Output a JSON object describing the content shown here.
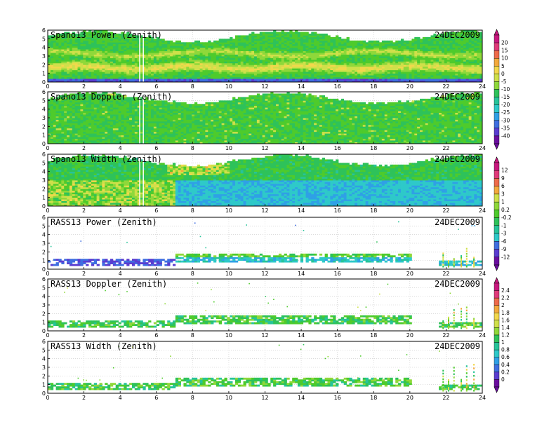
{
  "chart_data": [
    {
      "type": "heatmap",
      "title": "Spano13 Power (Zenith)",
      "date": "24DEC2009",
      "x_ticks": [
        "0",
        "2",
        "4",
        "6",
        "8",
        "10",
        "12",
        "14",
        "16",
        "18",
        "20",
        "22",
        "24"
      ],
      "y_ticks": [
        "0",
        "1",
        "2",
        "3",
        "4",
        "5",
        "6"
      ],
      "xlim": [
        0,
        24
      ],
      "ylim": [
        0,
        6
      ],
      "kind": "profiler-power",
      "colorbar": "snr"
    },
    {
      "type": "heatmap",
      "title": "Spano13 Doppler (Zenith)",
      "date": "24DEC2009",
      "x_ticks": [
        "0",
        "2",
        "4",
        "6",
        "8",
        "10",
        "12",
        "14",
        "16",
        "18",
        "20",
        "22",
        "24"
      ],
      "y_ticks": [
        "0",
        "1",
        "2",
        "3",
        "4",
        "5",
        "6"
      ],
      "xlim": [
        0,
        24
      ],
      "ylim": [
        0,
        6
      ],
      "kind": "profiler-doppler",
      "colorbar": "snr"
    },
    {
      "type": "heatmap",
      "title": "Spano13 Width (Zenith)",
      "date": "24DEC2009",
      "x_ticks": [
        "0",
        "2",
        "4",
        "6",
        "8",
        "10",
        "12",
        "14",
        "16",
        "18",
        "20",
        "22",
        "24"
      ],
      "y_ticks": [
        "0",
        "1",
        "2",
        "3",
        "4",
        "5",
        "6"
      ],
      "xlim": [
        0,
        24
      ],
      "ylim": [
        0,
        6
      ],
      "kind": "profiler-width",
      "colorbar": "doppler"
    },
    {
      "type": "heatmap",
      "title": "RASS13 Power (Zenith)",
      "date": "24DEC2009",
      "x_ticks": [
        "0",
        "2",
        "4",
        "6",
        "8",
        "10",
        "12",
        "14",
        "16",
        "18",
        "20",
        "22",
        "24"
      ],
      "y_ticks": [
        "0",
        "1",
        "2",
        "3",
        "4",
        "5",
        "6"
      ],
      "xlim": [
        0,
        24
      ],
      "ylim": [
        0,
        6
      ],
      "kind": "rass-power",
      "colorbar": "doppler"
    },
    {
      "type": "heatmap",
      "title": "RASS13 Doppler (Zenith)",
      "date": "24DEC2009",
      "x_ticks": [
        "0",
        "2",
        "4",
        "6",
        "8",
        "10",
        "12",
        "14",
        "16",
        "18",
        "20",
        "22",
        "24"
      ],
      "y_ticks": [
        "0",
        "1",
        "2",
        "3",
        "4",
        "5",
        "6"
      ],
      "xlim": [
        0,
        24
      ],
      "ylim": [
        0,
        6
      ],
      "kind": "rass-doppler",
      "colorbar": "width"
    },
    {
      "type": "heatmap",
      "title": "RASS13 Width (Zenith)",
      "date": "24DEC2009",
      "x_ticks": [
        "0",
        "2",
        "4",
        "6",
        "8",
        "10",
        "12",
        "14",
        "16",
        "18",
        "20",
        "22",
        "24"
      ],
      "y_ticks": [
        "0",
        "1",
        "2",
        "3",
        "4",
        "5",
        "6"
      ],
      "xlim": [
        0,
        24
      ],
      "ylim": [
        0,
        6
      ],
      "kind": "rass-width",
      "colorbar": "width"
    }
  ],
  "colorbars": {
    "snr": {
      "labels": [
        "20",
        "15",
        "10",
        "5",
        "0",
        "-5",
        "-10",
        "-15",
        "-20",
        "-25",
        "-30",
        "-35",
        "-40"
      ]
    },
    "doppler": {
      "labels": [
        "12",
        "9",
        "6",
        "3",
        "1",
        "0.2",
        "-0.2",
        "-1",
        "-3",
        "-6",
        "-9",
        "-12"
      ]
    },
    "width": {
      "labels": [
        "2.4",
        "2.2",
        "2",
        "1.8",
        "1.6",
        "1.4",
        "1.2",
        "1",
        "0.8",
        "0.6",
        "0.4",
        "0.2",
        "0"
      ]
    }
  },
  "colors": {
    "scale": [
      "#6a0d9e",
      "#5a3cd0",
      "#3f6ee0",
      "#2fa0e6",
      "#2ec9c9",
      "#27c49a",
      "#2ec25a",
      "#4ecb2c",
      "#8fd83a",
      "#cfe04a",
      "#f2d84c",
      "#f3a93c",
      "#ee6a4a",
      "#e03a7a",
      "#c8187e"
    ]
  }
}
